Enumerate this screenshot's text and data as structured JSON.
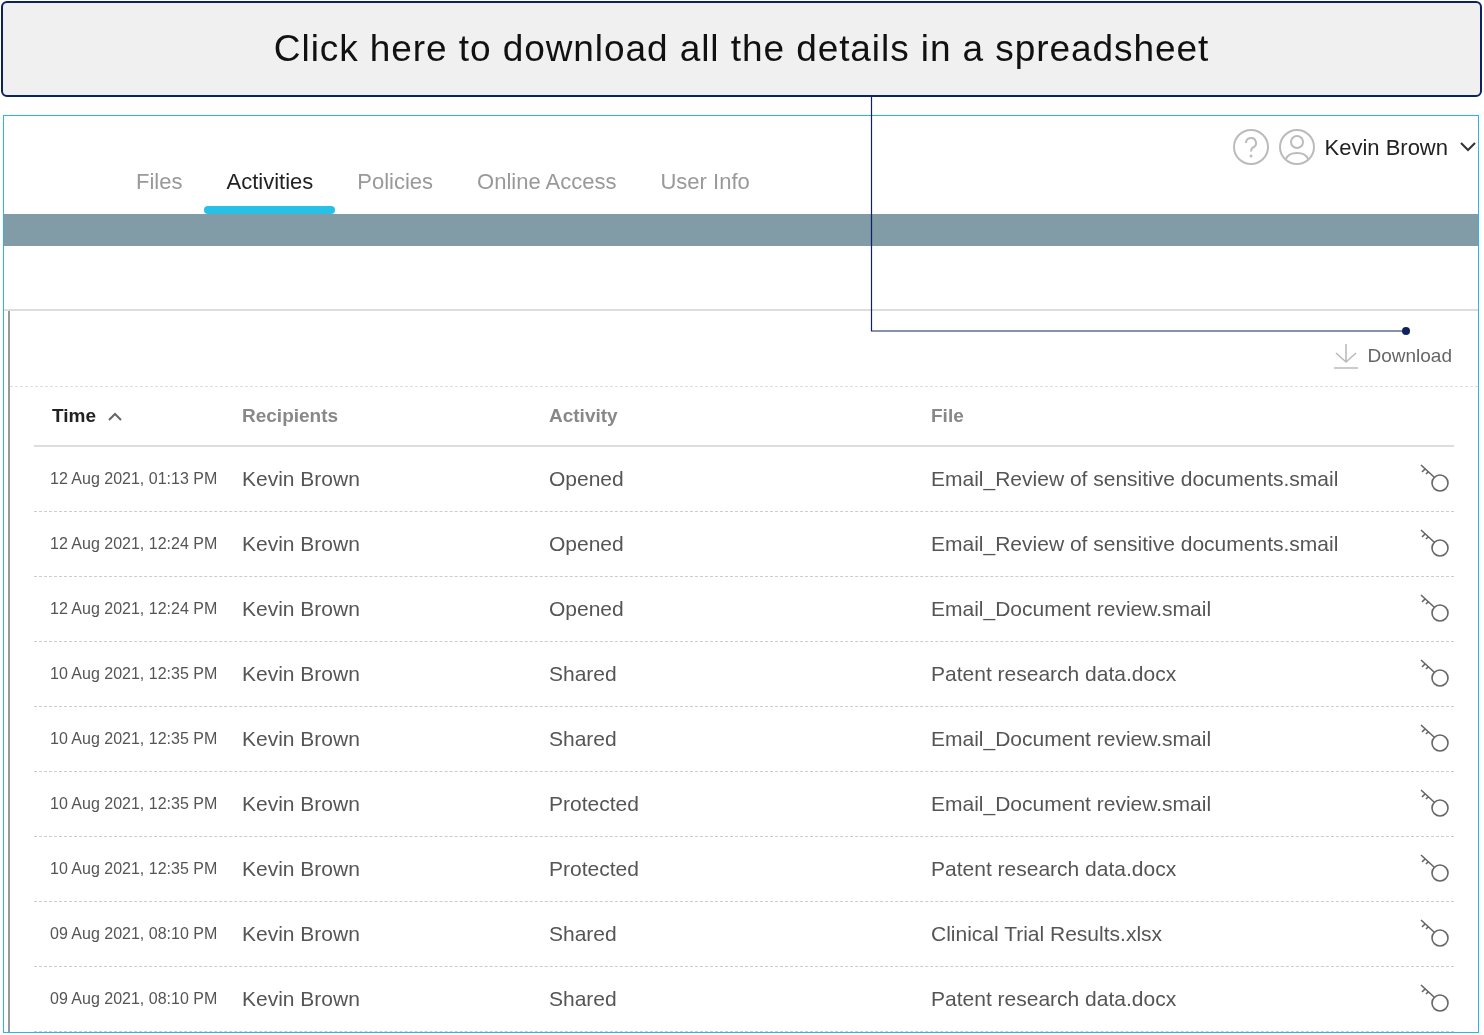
{
  "callout": {
    "text": "Click here to download all the details in a spreadsheet"
  },
  "tabs": [
    {
      "label": "Files",
      "selected": false
    },
    {
      "label": "Activities",
      "selected": true
    },
    {
      "label": "Policies",
      "selected": false
    },
    {
      "label": "Online Access",
      "selected": false
    },
    {
      "label": "User Info",
      "selected": false
    }
  ],
  "user": {
    "name": "Kevin Brown"
  },
  "toolbar": {
    "download": "Download"
  },
  "table": {
    "columns": [
      {
        "label": "Time",
        "sorted": true
      },
      {
        "label": "Recipients",
        "sorted": false
      },
      {
        "label": "Activity",
        "sorted": false
      },
      {
        "label": "File",
        "sorted": false
      }
    ],
    "rows": [
      {
        "time": "12 Aug 2021, 01:13 PM",
        "recipient": "Kevin Brown",
        "activity": "Opened",
        "file": "Email_Review of sensitive documents.smail"
      },
      {
        "time": "12 Aug 2021, 12:24 PM",
        "recipient": "Kevin Brown",
        "activity": "Opened",
        "file": "Email_Review of sensitive documents.smail"
      },
      {
        "time": "12 Aug 2021, 12:24 PM",
        "recipient": "Kevin Brown",
        "activity": "Opened",
        "file": "Email_Document review.smail"
      },
      {
        "time": "10 Aug 2021, 12:35 PM",
        "recipient": "Kevin Brown",
        "activity": "Shared",
        "file": "Patent research data.docx"
      },
      {
        "time": "10 Aug 2021, 12:35 PM",
        "recipient": "Kevin Brown",
        "activity": "Shared",
        "file": "Email_Document review.smail"
      },
      {
        "time": "10 Aug 2021, 12:35 PM",
        "recipient": "Kevin Brown",
        "activity": "Protected",
        "file": "Email_Document review.smail"
      },
      {
        "time": "10 Aug 2021, 12:35 PM",
        "recipient": "Kevin Brown",
        "activity": "Protected",
        "file": "Patent research data.docx"
      },
      {
        "time": "09 Aug 2021, 08:10 PM",
        "recipient": "Kevin Brown",
        "activity": "Shared",
        "file": "Clinical Trial Results.xlsx"
      },
      {
        "time": "09 Aug 2021, 08:10 PM",
        "recipient": "Kevin Brown",
        "activity": "Shared",
        "file": "Patent research data.docx"
      }
    ]
  }
}
